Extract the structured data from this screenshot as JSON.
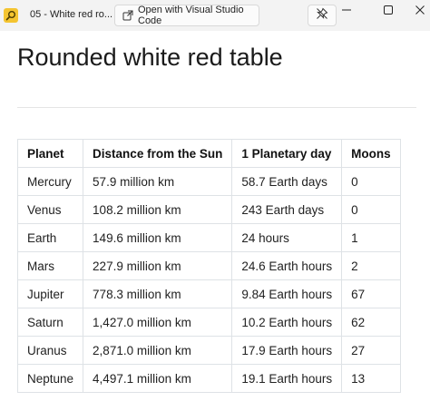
{
  "window": {
    "title": "05 - White red ro...",
    "open_with_label": "Open with Visual Studio Code"
  },
  "page": {
    "heading": "Rounded white red table"
  },
  "table": {
    "headers": [
      "Planet",
      "Distance from the Sun",
      "1 Planetary day",
      "Moons"
    ],
    "rows": [
      [
        "Mercury",
        "57.9 million km",
        "58.7 Earth days",
        "0"
      ],
      [
        "Venus",
        "108.2 million km",
        "243 Earth days",
        "0"
      ],
      [
        "Earth",
        "149.6 million km",
        "24 hours",
        "1"
      ],
      [
        "Mars",
        "227.9 million km",
        "24.6 Earth hours",
        "2"
      ],
      [
        "Jupiter",
        "778.3 million km",
        "9.84 Earth hours",
        "67"
      ],
      [
        "Saturn",
        "1,427.0 million km",
        "10.2 Earth hours",
        "62"
      ],
      [
        "Uranus",
        "2,871.0 million km",
        "17.9 Earth hours",
        "27"
      ],
      [
        "Neptune",
        "4,497.1 million km",
        "19.1 Earth hours",
        "13"
      ]
    ]
  },
  "icons": {
    "app": "search-folder-icon",
    "open_with": "open-external-icon",
    "pin": "unpin-icon",
    "minimize": "minimize-icon",
    "maximize": "maximize-icon",
    "close": "close-icon"
  }
}
